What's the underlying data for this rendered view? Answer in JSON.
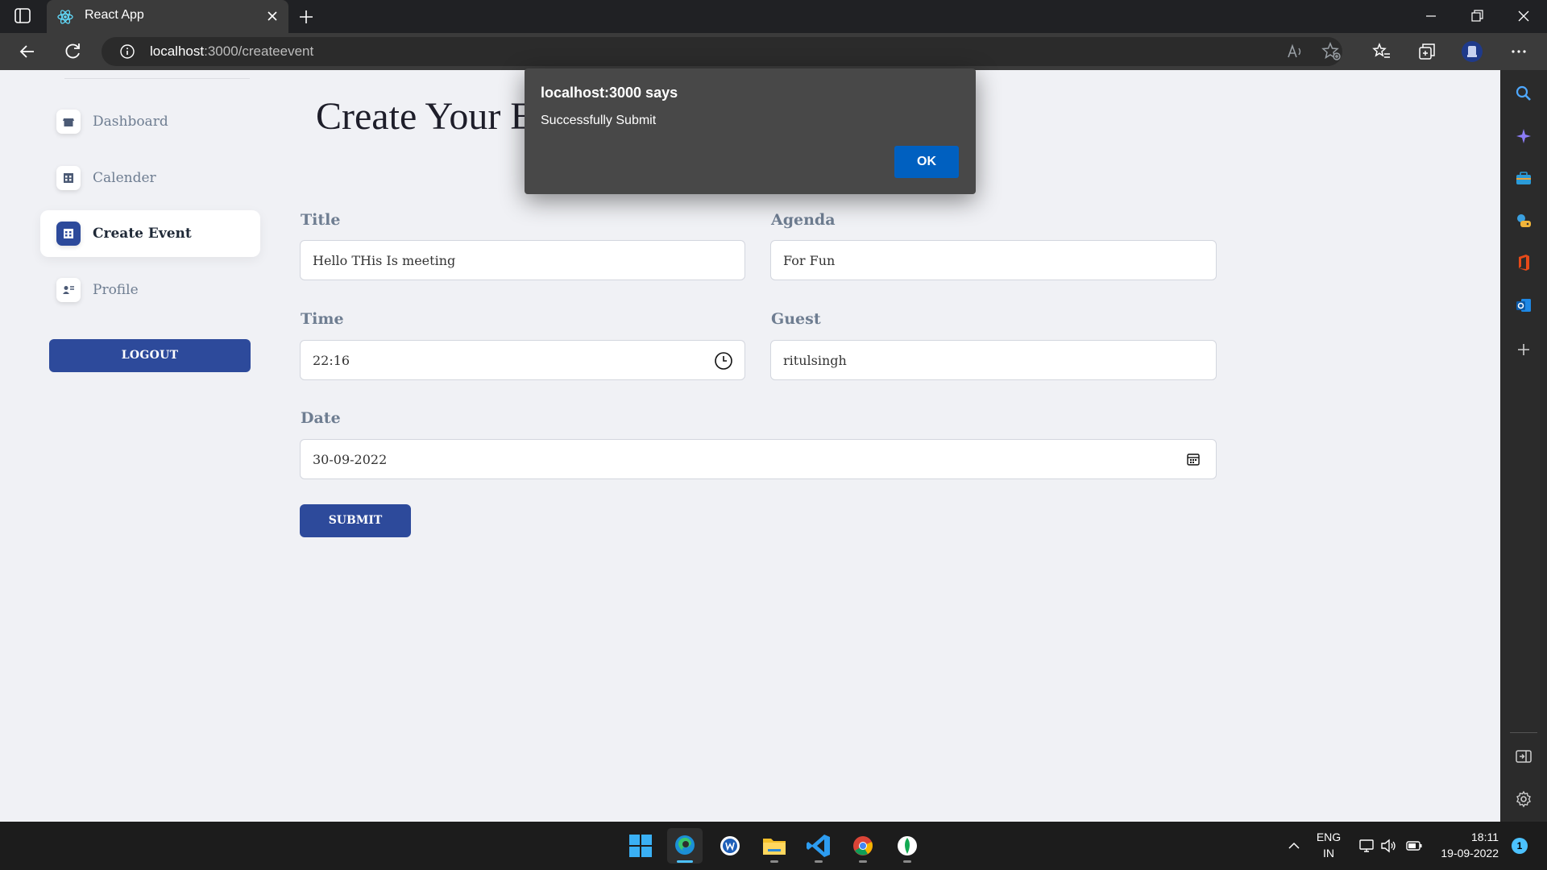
{
  "browser": {
    "tab_title": "React App",
    "url_host": "localhost",
    "url_path": ":3000/createevent"
  },
  "sidebar": {
    "items": [
      {
        "label": "Dashboard",
        "icon": "store-icon",
        "active": false
      },
      {
        "label": "Calender",
        "icon": "calendar-grid-icon",
        "active": false
      },
      {
        "label": "Create Event",
        "icon": "calendar-grid-icon",
        "active": true
      },
      {
        "label": "Profile",
        "icon": "user-card-icon",
        "active": false
      }
    ],
    "logout_label": "LOGOUT"
  },
  "main": {
    "title": "Create Your Ev",
    "fields": {
      "title": {
        "label": "Title",
        "value": "Hello THis Is meeting"
      },
      "agenda": {
        "label": "Agenda",
        "value": "For Fun"
      },
      "time": {
        "label": "Time",
        "value": "22:16"
      },
      "guest": {
        "label": "Guest",
        "value": "ritulsingh"
      },
      "date": {
        "label": "Date",
        "value": "30-09-2022"
      }
    },
    "submit_label": "SUBMIT"
  },
  "dialog": {
    "title": "localhost:3000 says",
    "message": "Successfully Submit",
    "ok_label": "OK"
  },
  "taskbar": {
    "lang_top": "ENG",
    "lang_bottom": "IN",
    "time": "18:11",
    "date": "19-09-2022",
    "notification_count": "1"
  },
  "colors": {
    "accent": "#2d4a9b",
    "page_bg": "#f0f1f5",
    "dialog_bg": "#484848",
    "dialog_button": "#0060c0"
  }
}
